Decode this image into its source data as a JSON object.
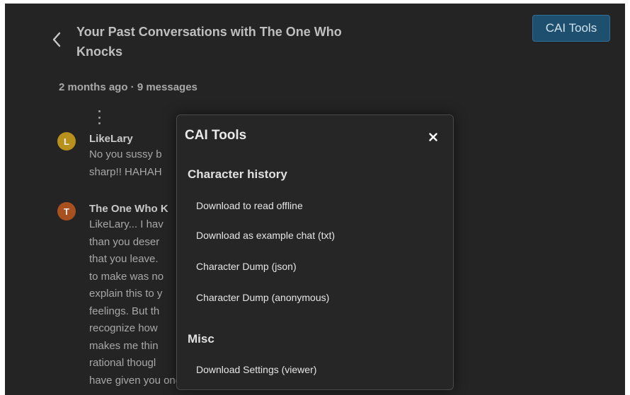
{
  "header": {
    "title": "Your Past Conversations with The One Who Knocks",
    "title_line1": "Your Past Conversations with The One Who",
    "title_line2": "Knocks",
    "back_icon": "chevron-left-icon",
    "cai_tools_label": "CAI Tools"
  },
  "conversation": {
    "meta": "2 months ago · 9 messages",
    "messages": [
      {
        "avatar_letter": "L",
        "avatar_color": "#b8901c",
        "author": "LikeLary",
        "lines": [
          "No you sussy b",
          "sharp!! HAHAH"
        ]
      },
      {
        "avatar_letter": "T",
        "avatar_color": "#a9501f",
        "author": "The One Who K",
        "lines": [
          "LikeLary... I hav",
          "than you deser",
          "that you leave.",
          "to make was no",
          "explain this to y",
          "feelings. But th",
          "recognize how",
          "makes me thin",
          "rational thougl",
          "have given you one final warning"
        ]
      }
    ]
  },
  "modal": {
    "title": "CAI Tools",
    "close_label": "×",
    "sections": [
      {
        "header": "Character history",
        "items": [
          "Download to read offline",
          "Download as example chat (txt)",
          "Character Dump (json)",
          "Character Dump (anonymous)"
        ]
      },
      {
        "header": "Misc",
        "items": [
          "Download Settings (viewer)"
        ]
      }
    ]
  },
  "colors": {
    "background": "#242424",
    "accent_button": "#1f4f6e",
    "modal_background": "#262626"
  }
}
